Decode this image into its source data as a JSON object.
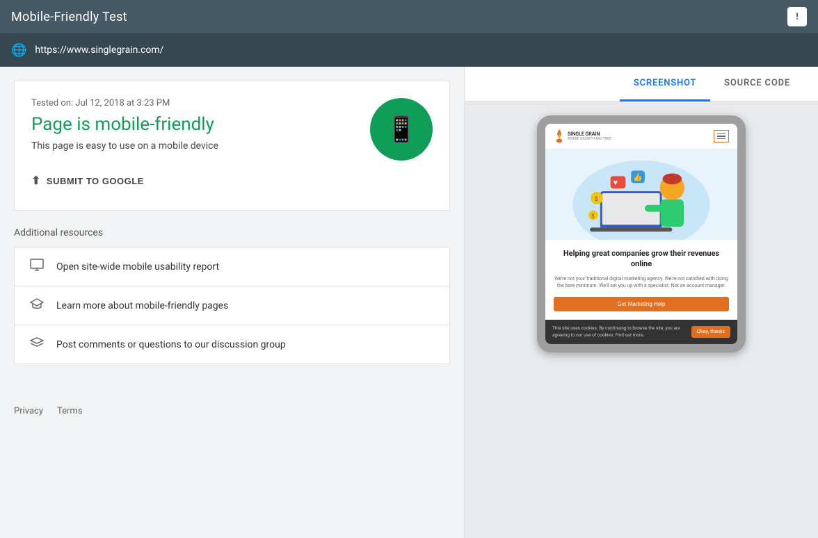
{
  "topbar": {
    "title": "Mobile-Friendly Test",
    "feedback_label": "!"
  },
  "urlbar": {
    "url": "https://www.singlegrain.com/"
  },
  "tabs": [
    {
      "id": "screenshot",
      "label": "SCREENSHOT",
      "active": true
    },
    {
      "id": "source-code",
      "label": "SOURCE CODE",
      "active": false
    }
  ],
  "result": {
    "date": "Tested on: Jul 12, 2018 at 3:23 PM",
    "title": "Page is mobile-friendly",
    "subtitle": "This page is easy to use on a mobile device",
    "submit_btn": "SUBMIT TO GOOGLE"
  },
  "additional": {
    "title": "Additional resources",
    "items": [
      {
        "label": "Open site-wide mobile usability report",
        "icon": "report"
      },
      {
        "label": "Learn more about mobile-friendly pages",
        "icon": "learn"
      },
      {
        "label": "Post comments or questions to our discussion group",
        "icon": "discuss"
      }
    ]
  },
  "footer": {
    "privacy": "Privacy",
    "terms": "Terms"
  },
  "preview": {
    "logo_name": "SINGLE GRAIN",
    "logo_tagline": "WHERE GROWTH MATTERS",
    "heading": "Helping great companies grow their revenues online",
    "body": "We're not your traditional digital marketing agency. We're not satisfied with doing the bare minimum. We'll set you up with a specialist. Not an account manager.",
    "cta": "Get Marketing Help",
    "cookie_text": "This site uses cookies. By continuing to browse the site, you are agreeing to our use of cookies. Find out more.",
    "cookie_btn": "Okay, thanks"
  },
  "colors": {
    "green": "#0f9d58",
    "topbar": "#455a64",
    "urlbar": "#37474f",
    "orange": "#e07020",
    "tab_active": "#1a73e8"
  }
}
